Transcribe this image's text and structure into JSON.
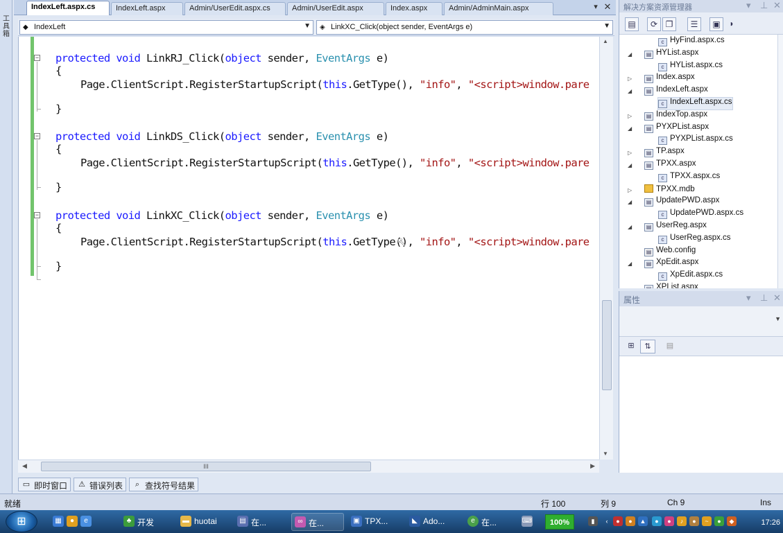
{
  "toolbox": {
    "label": "工具箱"
  },
  "tabs": [
    {
      "label": "IndexLeft.aspx.cs",
      "active": true
    },
    {
      "label": "IndexLeft.aspx"
    },
    {
      "label": "Admin/UserEdit.aspx.cs"
    },
    {
      "label": "Admin/UserEdit.aspx"
    },
    {
      "label": "Index.aspx"
    },
    {
      "label": "Admin/AdminMain.aspx"
    }
  ],
  "tab_controls": {
    "dropdown": "▾",
    "close": "✕"
  },
  "nav": {
    "class_select": "IndexLeft",
    "member_select": "LinkXC_Click(object sender, EventArgs e)"
  },
  "code": {
    "methods": [
      {
        "kw1": "protected",
        "kw2": "void",
        "name": "LinkRJ_Click(",
        "kw3": "object",
        "p1": " sender, ",
        "ty": "EventArgs",
        "p2": " e)"
      },
      {
        "kw1": "protected",
        "kw2": "void",
        "name": "LinkDS_Click(",
        "kw3": "object",
        "p1": " sender, ",
        "ty": "EventArgs",
        "p2": " e)"
      },
      {
        "kw1": "protected",
        "kw2": "void",
        "name": "LinkXC_Click(",
        "kw3": "object",
        "p1": " sender, ",
        "ty": "EventArgs",
        "p2": " e)"
      }
    ],
    "open_brace": "{",
    "close_brace": "}",
    "body_prefix": "Page.ClientScript.RegisterStartupScript(",
    "body_this": "this",
    "body_mid": ".GetType(), ",
    "body_info": "\"info\"",
    "body_comma": ", ",
    "body_script": "\"<script>window.pare"
  },
  "hscroll_thumb_label": "III",
  "bottom_tabs": [
    {
      "label": "即时窗口",
      "icon": "immediate-window-icon"
    },
    {
      "label": "错误列表",
      "icon": "error-list-icon"
    },
    {
      "label": "查找符号结果",
      "icon": "find-symbol-icon"
    }
  ],
  "solution_explorer": {
    "title": "解决方案资源管理器",
    "items": [
      {
        "label": "HyFind.aspx.cs",
        "level": 2,
        "type": "cs"
      },
      {
        "label": "HYList.aspx",
        "level": 1,
        "type": "aspx",
        "expanded": true
      },
      {
        "label": "HYList.aspx.cs",
        "level": 2,
        "type": "cs"
      },
      {
        "label": "Index.aspx",
        "level": 1,
        "type": "aspx",
        "expanded": false
      },
      {
        "label": "IndexLeft.aspx",
        "level": 1,
        "type": "aspx",
        "expanded": true
      },
      {
        "label": "IndexLeft.aspx.cs",
        "level": 2,
        "type": "cs",
        "selected": true
      },
      {
        "label": "IndexTop.aspx",
        "level": 1,
        "type": "aspx",
        "expanded": false
      },
      {
        "label": "PYXPList.aspx",
        "level": 1,
        "type": "aspx",
        "expanded": true
      },
      {
        "label": "PYXPList.aspx.cs",
        "level": 2,
        "type": "cs"
      },
      {
        "label": "TP.aspx",
        "level": 1,
        "type": "aspx",
        "expanded": false
      },
      {
        "label": "TPXX.aspx",
        "level": 1,
        "type": "aspx",
        "expanded": true
      },
      {
        "label": "TPXX.aspx.cs",
        "level": 2,
        "type": "cs"
      },
      {
        "label": "TPXX.mdb",
        "level": 1,
        "type": "db",
        "expanded": false
      },
      {
        "label": "UpdatePWD.aspx",
        "level": 1,
        "type": "aspx",
        "expanded": true
      },
      {
        "label": "UpdatePWD.aspx.cs",
        "level": 2,
        "type": "cs"
      },
      {
        "label": "UserReg.aspx",
        "level": 1,
        "type": "aspx",
        "expanded": true
      },
      {
        "label": "UserReg.aspx.cs",
        "level": 2,
        "type": "cs"
      },
      {
        "label": "Web.config",
        "level": 1,
        "type": "cfg"
      },
      {
        "label": "XpEdit.aspx",
        "level": 1,
        "type": "aspx",
        "expanded": true
      },
      {
        "label": "XpEdit.aspx.cs",
        "level": 2,
        "type": "cs"
      },
      {
        "label": "XPList.aspx",
        "level": 1,
        "type": "aspx"
      }
    ]
  },
  "properties": {
    "title": "属性"
  },
  "statusbar": {
    "ready": "就绪",
    "line": "行 100",
    "col": "列 9",
    "ch": "Ch 9",
    "mode": "Ins"
  },
  "taskbar": {
    "items": [
      {
        "label": "开发"
      },
      {
        "label": "huotai"
      },
      {
        "label": "在..."
      },
      {
        "label": "在..."
      },
      {
        "label": "TPX..."
      },
      {
        "label": "Ado..."
      },
      {
        "label": "在..."
      }
    ],
    "zoom": "100%",
    "clock": "17:26"
  },
  "colors": {
    "keyword": "#1a1aff",
    "type": "#2b91af",
    "string": "#a31515",
    "changebar": "#72c46c"
  }
}
